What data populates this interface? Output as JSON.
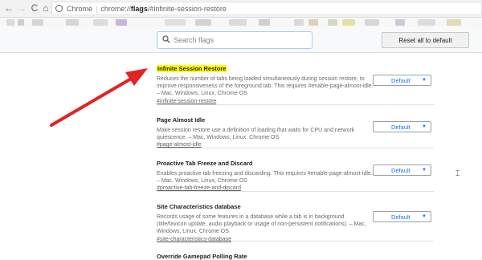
{
  "browser": {
    "secure_label": "Chrome",
    "url_host": "chrome://",
    "url_path_bold": "flags",
    "url_rest": "/#infinite-session-restore",
    "nav_back": "←",
    "nav_forward": "→",
    "nav_reload": "C",
    "nav_home": "⌂"
  },
  "header": {
    "search_placeholder": "Search flags",
    "reset_label": "Reset all to default"
  },
  "flags": [
    {
      "title": "Infinite Session Restore",
      "description": "Reduces the number of tabs being loaded simultaneously during session restore, to improve responsiveness of the foreground tab. This requires #enable-page-almost-idle. – Mac, Windows, Linux, Chrome OS",
      "link": "#infinite-session-restore",
      "value": "Default",
      "highlighted": true
    },
    {
      "title": "Page Almost Idle",
      "description": "Make session restore use a definition of loading that waits for CPU and network quiescence. – Mac, Windows, Linux, Chrome OS",
      "link": "#page-almost-idle",
      "value": "Default",
      "highlighted": false
    },
    {
      "title": "Proactive Tab Freeze and Discard",
      "description": "Enables proactive tab freezing and discarding. This requires #enable-page-almost-idle. – Mac, Windows, Linux, Chrome OS",
      "link": "#proactive-tab-freeze-and-discard",
      "value": "Default",
      "highlighted": false
    },
    {
      "title": "Site Characteristics database",
      "description": "Records usage of some features in a database while a tab is in background (title/favicon update, audio playback or usage of non-persistent notifications). – Mac, Windows, Linux, Chrome OS",
      "link": "#site-characteristics-database",
      "value": "Default",
      "highlighted": false
    },
    {
      "title": "Override Gamepad Polling Rate",
      "description": "",
      "link": "",
      "value": "",
      "highlighted": false
    }
  ],
  "colors": {
    "highlight": "#ffff00",
    "arrow": "#e32222",
    "select_text": "#1a73e8"
  },
  "icons": {
    "search": "search-icon",
    "secure": "chrome-info-icon",
    "caret": "chevron-down-icon"
  }
}
